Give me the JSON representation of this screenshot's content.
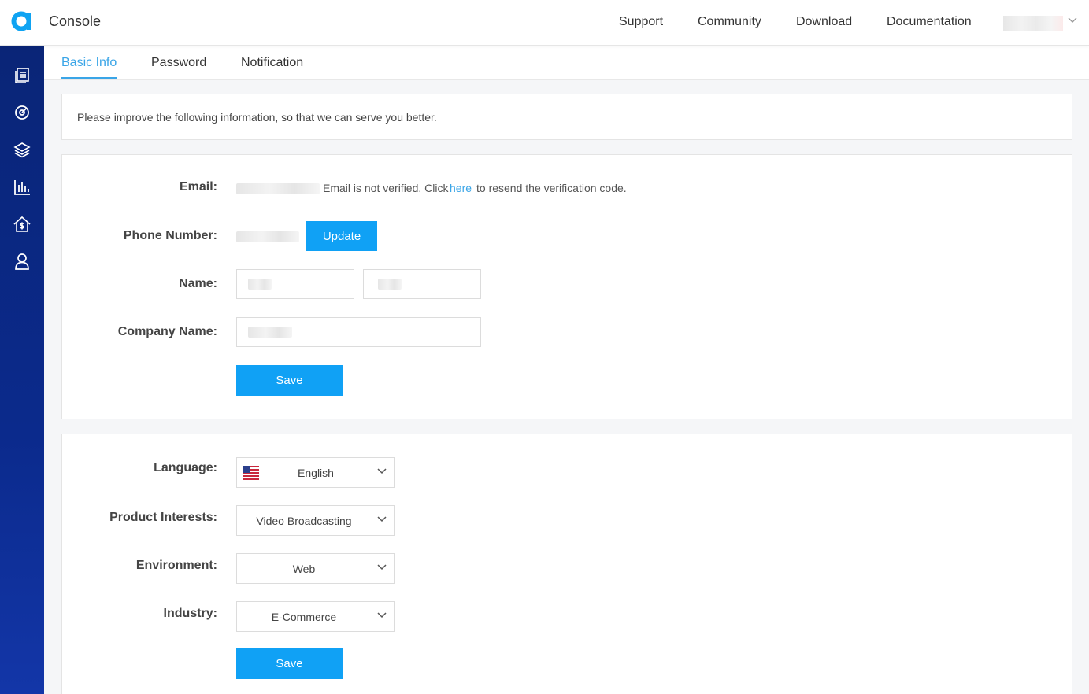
{
  "header": {
    "title": "Console",
    "nav": [
      "Support",
      "Community",
      "Download",
      "Documentation"
    ]
  },
  "sidebar": {
    "icons": [
      "document-list-icon",
      "target-icon",
      "layers-icon",
      "bar-chart-icon",
      "billing-home-icon",
      "user-icon"
    ]
  },
  "tabs": [
    "Basic Info",
    "Password",
    "Notification"
  ],
  "notice": "Please improve the following information, so that we can serve you better.",
  "basic_info": {
    "email_label": "Email:",
    "email_status_prefix": "Email is not verified. Click",
    "email_link": "here",
    "email_status_suffix": "to resend the verification code.",
    "phone_label": "Phone Number:",
    "update_label": "Update",
    "name_label": "Name:",
    "company_label": "Company Name:",
    "save_label": "Save"
  },
  "preferences": {
    "language_label": "Language:",
    "language_value": "English",
    "interests_label": "Product Interests:",
    "interests_value": "Video Broadcasting",
    "environment_label": "Environment:",
    "environment_value": "Web",
    "industry_label": "Industry:",
    "industry_value": "E-Commerce",
    "save_label": "Save"
  },
  "colors": {
    "accent": "#3aa5e7",
    "button": "#10a1f5",
    "sidebar": "#0b2a8c"
  }
}
